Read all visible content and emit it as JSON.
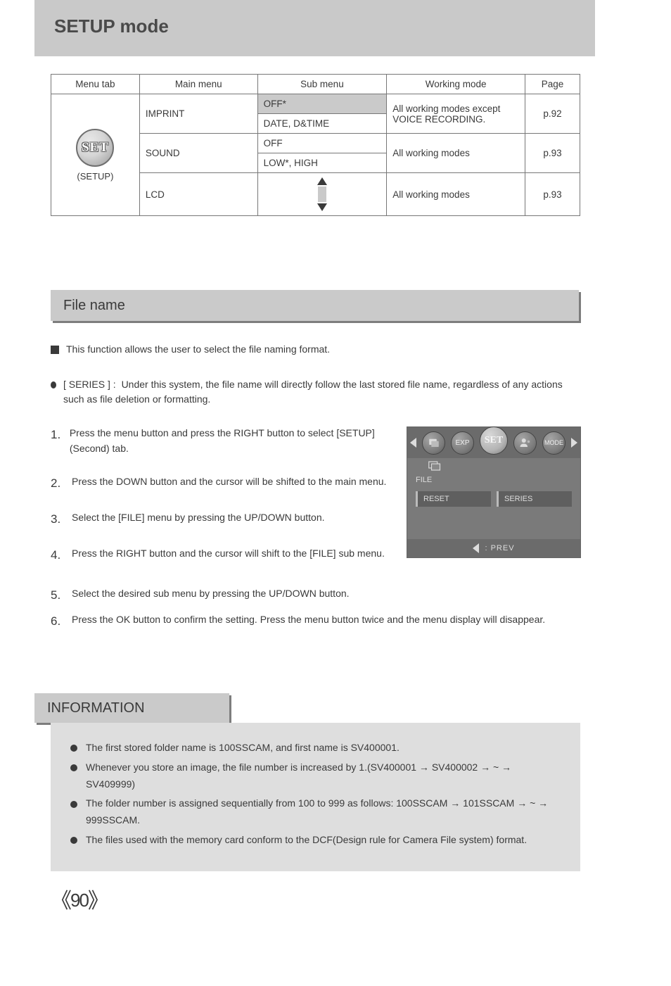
{
  "page_title": "SETUP mode",
  "table": {
    "headers": [
      "Menu tab",
      "Main menu",
      "Sub menu",
      "Working mode",
      "Page"
    ],
    "col0_label": "(SETUP)",
    "rows": [
      {
        "main": "IMPRINT",
        "subs": [
          {
            "s": "OFF*",
            "w": "All working modes except VOICE RECORDING.",
            "hl": true
          },
          {
            "s": "DATE, D&TIME",
            "w": "",
            "hl": false
          }
        ],
        "page": "p.92"
      },
      {
        "main": "SOUND",
        "subs": [
          {
            "s": "OFF",
            "w": "All working modes",
            "hl": false
          },
          {
            "s": "LOW*, HIGH",
            "w": "",
            "hl": false
          }
        ],
        "page": "p.93"
      },
      {
        "main": "LCD",
        "subs": [
          {
            "s": "__slider__",
            "w": "All working modes",
            "hl": false
          }
        ],
        "page": "p.93"
      }
    ]
  },
  "section_heading": "File name",
  "body": {
    "intro": "This function allows the user to select the file naming format.",
    "series_label": "[ SERIES ] :",
    "series_text": "Under this system, the file name will directly follow the last stored file name, regardless of any actions such as file deletion or formatting.",
    "steps": [
      {
        "n": "1.",
        "t": "Press the menu button and press the RIGHT button to select [SETUP](Second) tab."
      },
      {
        "n": "2.",
        "t": "Press the DOWN button and the cursor will be shifted to the main menu."
      },
      {
        "n": "3.",
        "t": "Select the [FILE] menu by pressing the UP/DOWN button."
      },
      {
        "n": "4.",
        "t": "Press the RIGHT button and the cursor will shift to the [FILE] sub menu."
      }
    ],
    "after": [
      {
        "n": "5.",
        "t": "Select the desired sub menu by pressing the UP/DOWN button."
      },
      {
        "n": "6.",
        "t": "Press the OK button to confirm the setting. Press the menu button twice and the menu display will disappear."
      }
    ]
  },
  "screen": {
    "sub_label": "FILE",
    "opts": [
      "RESET",
      "SERIES"
    ],
    "footer": "PREV",
    "tabs": [
      "gallery-icon",
      "EXP",
      "SET",
      "person-icon",
      "MODE"
    ]
  },
  "info": {
    "title": "INFORMATION",
    "items": [
      "The first stored folder name is 100SSCAM, and first name is SV400001.",
      "Whenever you store an image, the file number is increased by 1.(SV400001 → SV400002 → ~ → SV409999)",
      "The folder number is assigned sequentially from 100 to 999 as follows: 100SSCAM → 101SSCAM → ~ → 999SSCAM.",
      "The files used with the memory card conform to the DCF(Design rule for Camera File system) format."
    ]
  },
  "page_number": "90"
}
